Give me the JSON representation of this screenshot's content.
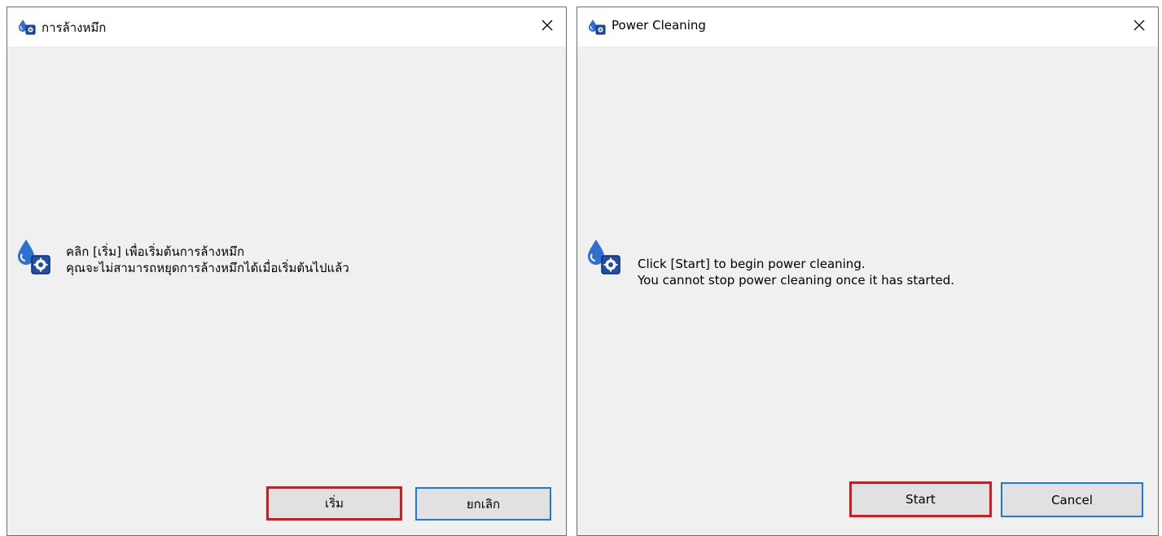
{
  "thai_dialog": {
    "title": "การล้างหมึก",
    "message_line1": "คลิก [เริ่ม] เพื่อเริ่มต้นการล้างหมึก",
    "message_line2": "คุณจะไม่สามารถหยุดการล้างหมึกได้เมื่อเริ่มต้นไปแล้ว",
    "start_label": "เริ่ม",
    "cancel_label": "ยกเลิก"
  },
  "english_dialog": {
    "title": "Power Cleaning",
    "message_line1": "Click [Start] to begin power cleaning.",
    "message_line2": "You cannot stop power cleaning once it has started.",
    "start_label": "Start",
    "cancel_label": "Cancel"
  },
  "icons": {
    "app": "ink-cleaning-icon",
    "message": "ink-cleaning-icon",
    "close": "close-icon"
  },
  "colors": {
    "highlight_border": "#e0151b",
    "focus_border": "#1a7cd6",
    "window_background": "#f0f0f0"
  }
}
